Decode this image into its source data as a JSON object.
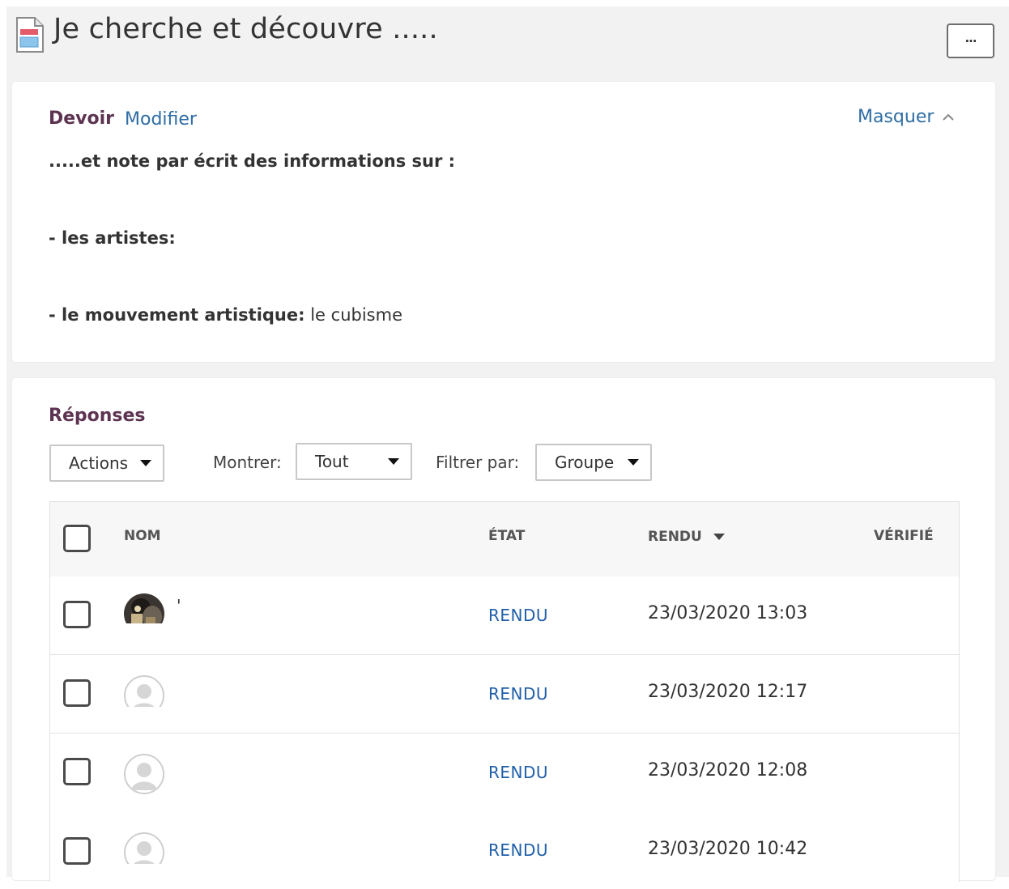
{
  "header": {
    "title": "Je cherche et découvre .....",
    "more_label": "···",
    "icon": "document-icon"
  },
  "assignment": {
    "heading": "Devoir",
    "edit_link": "Modifier",
    "hide_link": "Masquer",
    "line1": ".....et note par écrit des informations sur :",
    "line2": "- les artistes:",
    "line3_bold": "- le mouvement artistique:",
    "line3_value": "le cubisme"
  },
  "responses": {
    "heading": "Réponses",
    "actions_label": "Actions",
    "show_label": "Montrer:",
    "show_value": "Tout",
    "filter_label": "Filtrer par:",
    "filter_value": "Groupe",
    "columns": {
      "name": "NOM",
      "state": "ÉTAT",
      "submitted": "RENDU",
      "verified": "VÉRIFIÉ"
    },
    "rows": [
      {
        "name": "'",
        "state": "RENDU",
        "submitted": "23/03/2020 13:03",
        "avatar": "photo-avatar"
      },
      {
        "name": "",
        "state": "RENDU",
        "submitted": "23/03/2020 12:17",
        "avatar": "default-avatar"
      },
      {
        "name": "",
        "state": "RENDU",
        "submitted": "23/03/2020 12:08",
        "avatar": "default-avatar"
      },
      {
        "name": "",
        "state": "RENDU",
        "submitted": "23/03/2020 10:42",
        "avatar": "default-avatar"
      }
    ]
  },
  "colors": {
    "heading": "#5c3350",
    "link": "#2e6da4",
    "status": "#1f5fa8",
    "background": "#f2f2f2"
  }
}
